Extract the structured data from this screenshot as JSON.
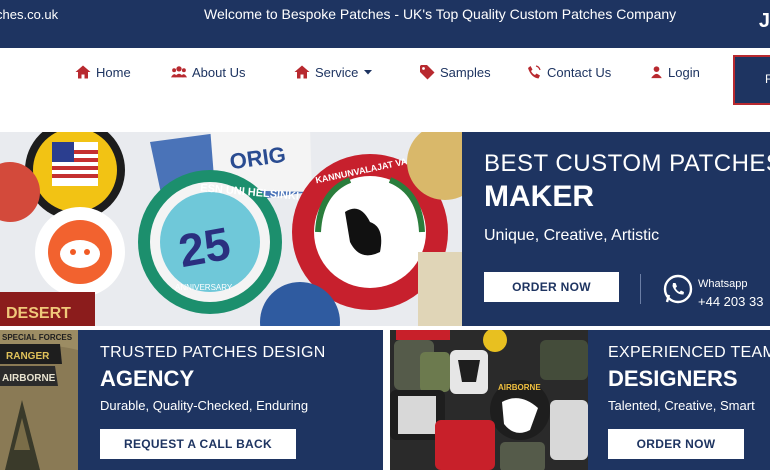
{
  "topbar": {
    "email": "ches.co.uk",
    "welcome": "Welcome to Bespoke Patches - UK's Top Quality Custom Patches Company",
    "corner_glyph": "J"
  },
  "nav": {
    "items": [
      {
        "label": "Home",
        "icon": "home-icon"
      },
      {
        "label": "About Us",
        "icon": "users-icon"
      },
      {
        "label": "Service",
        "icon": "home-icon"
      },
      {
        "label": "Samples",
        "icon": "tag-icon"
      },
      {
        "label": "Contact Us",
        "icon": "phone-icon"
      },
      {
        "label": "Login",
        "icon": "user-icon"
      }
    ],
    "cta_label": "F",
    "accent": "#b8292f"
  },
  "hero": {
    "line1": "BEST CUSTOM PATCHES",
    "line2": "MAKER",
    "sub": "Unique, Creative, Artistic",
    "order_label": "ORDER NOW",
    "whatsapp_label": "Whatsapp",
    "whatsapp_phone": "+44 203 33",
    "patch_texts": {
      "esn": "ESN UNI HELSINKI",
      "num": "25",
      "ann": "ANNIVERSARY",
      "kann": "KANNUNVALAJAT VALTIOTIETEELLINEN TDK",
      "desert": "DESERT",
      "orig": "ORIG"
    }
  },
  "cards": [
    {
      "title1": "TRUSTED PATCHES DESIGN",
      "title2": "AGENCY",
      "sub": "Durable, Quality-Checked, Enduring",
      "button": "REQUEST A CALL BACK",
      "thumb_texts": [
        "SPECIAL FORCES",
        "RANGER",
        "AIRBORNE"
      ]
    },
    {
      "title1": "EXPERIENCED TEAM",
      "title2": "DESIGNERS",
      "sub": "Talented, Creative, Smart",
      "button": "ORDER NOW",
      "thumb_texts": [
        "AIRBORNE"
      ]
    }
  ],
  "colors": {
    "navy": "#1e3461",
    "white": "#ffffff",
    "red": "#b8292f"
  }
}
